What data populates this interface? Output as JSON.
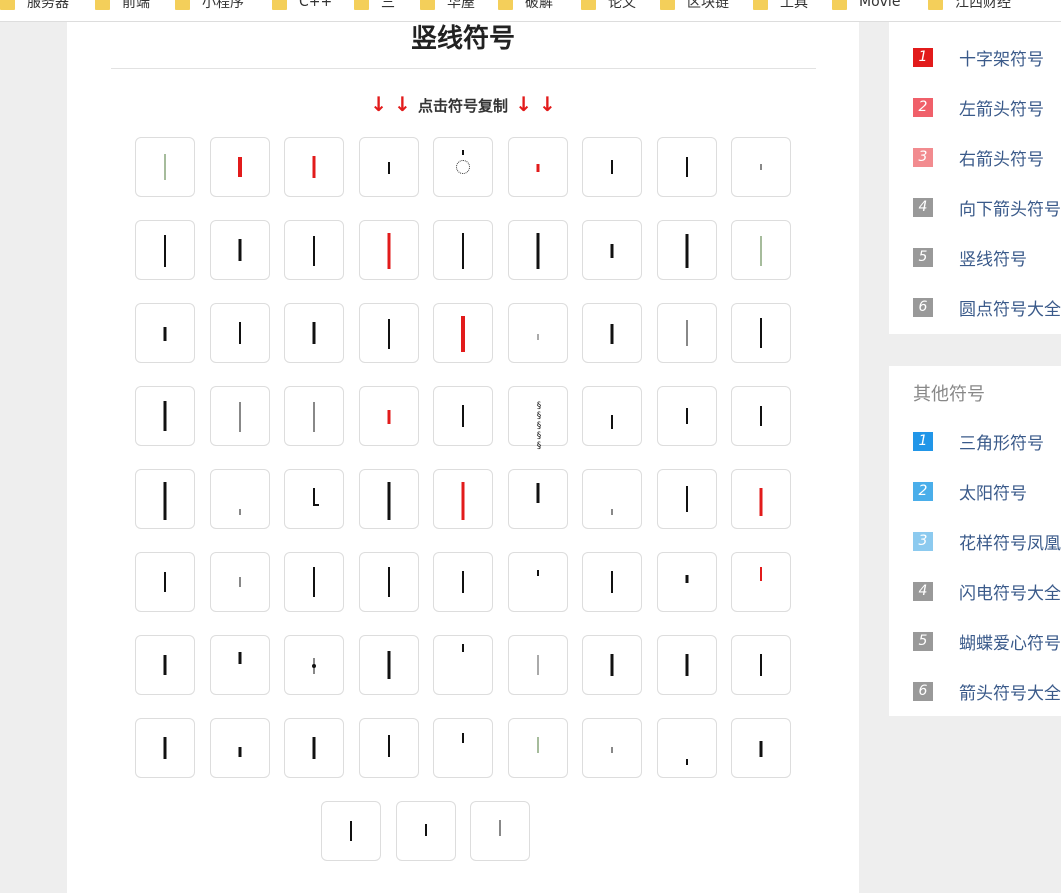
{
  "bookmarks": [
    "服务器",
    "前端",
    "小程序",
    "C++",
    "三",
    "华屋",
    "破解",
    "论文",
    "区块链",
    "工具",
    "Movie",
    "江西财经"
  ],
  "page": {
    "title": "竖线符号",
    "hint_arrows_left": "↓ ↓",
    "hint_text": "点击符号复制",
    "hint_arrows_right": "↓ ↓"
  },
  "symbols": {
    "count": 76,
    "colors": {
      "black": "#111111",
      "red": "#e21b1b",
      "green": "#4c7a3a"
    }
  },
  "sidebar_top": {
    "items": [
      {
        "num": "1",
        "label": "十字架符号",
        "color": "#e21b1b"
      },
      {
        "num": "2",
        "label": "左箭头符号",
        "color": "#f0606a"
      },
      {
        "num": "3",
        "label": "右箭头符号",
        "color": "#f28b8f"
      },
      {
        "num": "4",
        "label": "向下箭头符号",
        "color": "#999999"
      },
      {
        "num": "5",
        "label": "竖线符号",
        "color": "#999999"
      },
      {
        "num": "6",
        "label": "圆点符号大全",
        "color": "#999999"
      }
    ]
  },
  "sidebar_other": {
    "heading": "其他符号",
    "items": [
      {
        "num": "1",
        "label": "三角形符号",
        "color": "#2196e8"
      },
      {
        "num": "2",
        "label": "太阳符号",
        "color": "#4aaeea"
      },
      {
        "num": "3",
        "label": "花样符号凤凰",
        "color": "#8ccaef"
      },
      {
        "num": "4",
        "label": "闪电符号大全",
        "color": "#999999"
      },
      {
        "num": "5",
        "label": "蝴蝶爱心符号",
        "color": "#999999"
      },
      {
        "num": "6",
        "label": "箭头符号大全",
        "color": "#999999"
      }
    ]
  }
}
